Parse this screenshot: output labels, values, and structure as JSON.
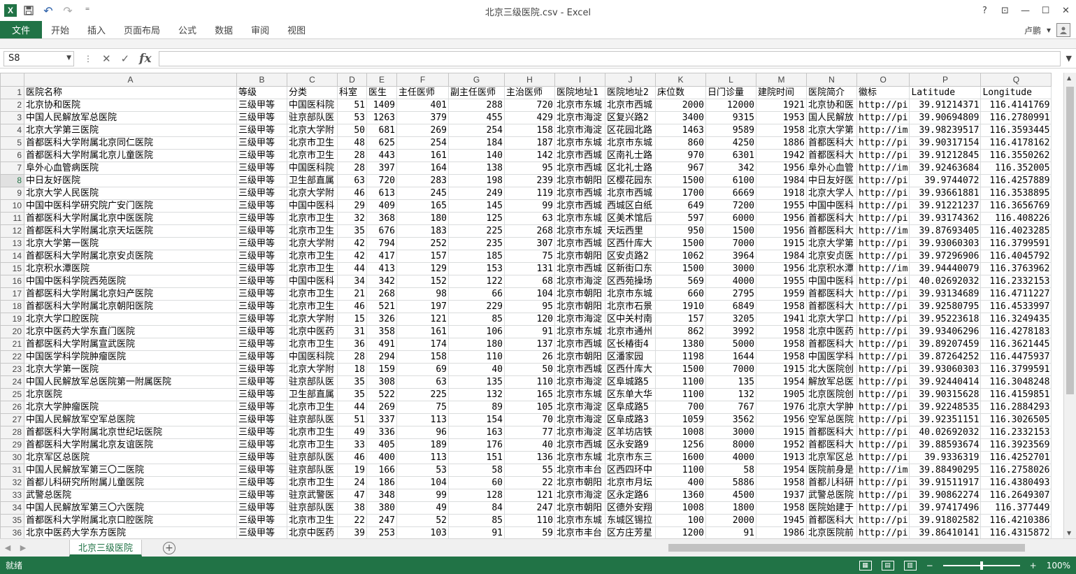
{
  "window": {
    "title": "北京三级医院.csv - Excel",
    "help": "?",
    "ribbon_display": "⊡",
    "minimize": "—",
    "maximize": "☐",
    "close": "✕"
  },
  "qat": {
    "app_icon": "X",
    "save_icon": "💾",
    "undo_icon": "↶",
    "redo_icon": "↷",
    "customize_icon": "⁼"
  },
  "ribbon": {
    "file_tab": "文件",
    "tabs": [
      "开始",
      "插入",
      "页面布局",
      "公式",
      "数据",
      "审阅",
      "视图"
    ],
    "user_name": "卢鹏",
    "user_dropdown": "▾"
  },
  "formula_bar": {
    "name_box": "S8",
    "cancel_icon": "✕",
    "enter_icon": "✓",
    "fx_label": "fx",
    "formula_value": ""
  },
  "grid": {
    "columns": [
      "A",
      "B",
      "C",
      "D",
      "E",
      "F",
      "G",
      "H",
      "I",
      "J",
      "K",
      "L",
      "M",
      "N",
      "O",
      "P",
      "Q"
    ],
    "selected_row": 8,
    "rows": [
      [
        "1",
        "医院名称",
        "等级",
        "分类",
        "科室",
        "医生",
        "主任医师",
        "副主任医师",
        "主治医师",
        "医院地址1",
        "医院地址2",
        "床位数",
        "日门诊量",
        "建院时间",
        "医院简介",
        "徽标",
        "Latitude",
        "Longitude"
      ],
      [
        "2",
        "北京协和医院",
        "三级甲等",
        "中国医科院",
        "51",
        "1409",
        "401",
        "288",
        "720",
        "北京市东城",
        "北京市西城",
        "2000",
        "12000",
        "1921",
        "北京协和医",
        "http://pi",
        "39.91214371",
        "116.4141769"
      ],
      [
        "3",
        "中国人民解放军总医院",
        "三级甲等",
        "驻京部队医",
        "53",
        "1263",
        "379",
        "455",
        "429",
        "北京市海淀",
        "区复兴路2",
        "3400",
        "9315",
        "1953",
        "国人民解放",
        "http://pi",
        "39.90694809",
        "116.2780991"
      ],
      [
        "4",
        "北京大学第三医院",
        "三级甲等",
        "北京大学附",
        "50",
        "681",
        "269",
        "254",
        "158",
        "北京市海淀",
        "区花园北路",
        "1463",
        "9589",
        "1958",
        "北京大学第",
        "http://im",
        "39.98239517",
        "116.3593445"
      ],
      [
        "5",
        "首都医科大学附属北京同仁医院",
        "三级甲等",
        "北京市卫生",
        "48",
        "625",
        "254",
        "184",
        "187",
        "北京市东城",
        "北京市东城",
        "860",
        "4250",
        "1886",
        "首都医科大",
        "http://pi",
        "39.90317154",
        "116.4178162"
      ],
      [
        "6",
        "首都医科大学附属北京儿童医院",
        "三级甲等",
        "北京市卫生",
        "28",
        "443",
        "161",
        "140",
        "142",
        "北京市西城",
        "区南礼士路",
        "970",
        "6301",
        "1942",
        "首都医科大",
        "http://pi",
        "39.91212845",
        "116.3550262"
      ],
      [
        "7",
        "阜外心血管病医院",
        "三级甲等",
        "中国医科院",
        "28",
        "397",
        "164",
        "138",
        "95",
        "北京市西城",
        "区北礼士路",
        "967",
        "342",
        "1956",
        "阜外心血管",
        "http://im",
        "39.92463684",
        "116.352005"
      ],
      [
        "8",
        "中日友好医院",
        "三级甲等",
        "卫生部直属",
        "63",
        "720",
        "283",
        "198",
        "239",
        "北京市朝阳",
        "区樱花园东",
        "1500",
        "6100",
        "1984",
        "中日友好医",
        "http://pi",
        "39.9744072",
        "116.4257889"
      ],
      [
        "9",
        "北京大学人民医院",
        "三级甲等",
        "北京大学附",
        "46",
        "613",
        "245",
        "249",
        "119",
        "北京市西城",
        "北京市西城",
        "1700",
        "6669",
        "1918",
        "北京大学人",
        "http://pi",
        "39.93661881",
        "116.3538895"
      ],
      [
        "10",
        "中国中医科学研究院广安门医院",
        "三级甲等",
        "中国中医科",
        "29",
        "409",
        "165",
        "145",
        "99",
        "北京市西城",
        "西城区白纸",
        "649",
        "7200",
        "1955",
        "中国中医科",
        "http://pi",
        "39.91221237",
        "116.3656769"
      ],
      [
        "11",
        "首都医科大学附属北京中医医院",
        "三级甲等",
        "北京市卫生",
        "32",
        "368",
        "180",
        "125",
        "63",
        "北京市东城",
        "区美术馆后",
        "597",
        "6000",
        "1956",
        "首都医科大",
        "http://pi",
        "39.93174362",
        "116.408226"
      ],
      [
        "12",
        "首都医科大学附属北京天坛医院",
        "三级甲等",
        "北京市卫生",
        "35",
        "676",
        "183",
        "225",
        "268",
        "北京市东城",
        "天坛西里",
        "950",
        "1500",
        "1956",
        "首都医科大",
        "http://im",
        "39.87693405",
        "116.4023285"
      ],
      [
        "13",
        "北京大学第一医院",
        "三级甲等",
        "北京大学附",
        "42",
        "794",
        "252",
        "235",
        "307",
        "北京市西城",
        "区西什库大",
        "1500",
        "7000",
        "1915",
        "北京大学第",
        "http://pi",
        "39.93060303",
        "116.3799591"
      ],
      [
        "14",
        "首都医科大学附属北京安贞医院",
        "三级甲等",
        "北京市卫生",
        "42",
        "417",
        "157",
        "185",
        "75",
        "北京市朝阳",
        "区安贞路2",
        "1062",
        "3964",
        "1984",
        "北京安贞医",
        "http://pi",
        "39.97296906",
        "116.4045792"
      ],
      [
        "15",
        "北京积水潭医院",
        "三级甲等",
        "北京市卫生",
        "44",
        "413",
        "129",
        "153",
        "131",
        "北京市西城",
        "区新街口东",
        "1500",
        "3000",
        "1956",
        "北京积水潭",
        "http://im",
        "39.94440079",
        "116.3763962"
      ],
      [
        "16",
        "中国中医科学院西苑医院",
        "三级甲等",
        "中国中医科",
        "34",
        "342",
        "152",
        "122",
        "68",
        "北京市海淀",
        "区西苑操场",
        "569",
        "4000",
        "1955",
        "中国中医科",
        "http://pi",
        "40.02692032",
        "116.2332153"
      ],
      [
        "17",
        "首都医科大学附属北京妇产医院",
        "三级甲等",
        "北京市卫生",
        "21",
        "268",
        "98",
        "66",
        "104",
        "北京市朝阳",
        "北京市东城",
        "660",
        "2795",
        "1959",
        "首都医科大",
        "http://pi",
        "39.93134689",
        "116.4711227"
      ],
      [
        "18",
        "首都医科大学附属北京朝阳医院",
        "三级甲等",
        "北京市卫生",
        "46",
        "521",
        "197",
        "229",
        "95",
        "北京市朝阳",
        "北京市石景",
        "1910",
        "6849",
        "1958",
        "首都医科大",
        "http://pi",
        "39.92580795",
        "116.4533997"
      ],
      [
        "19",
        "北京大学口腔医院",
        "三级甲等",
        "北京大学附",
        "15",
        "326",
        "121",
        "85",
        "120",
        "北京市海淀",
        "区中关村南",
        "157",
        "3205",
        "1941",
        "北京大学口",
        "http://pi",
        "39.95223618",
        "116.3249435"
      ],
      [
        "20",
        "北京中医药大学东直门医院",
        "三级甲等",
        "北京中医药",
        "31",
        "358",
        "161",
        "106",
        "91",
        "北京市东城",
        "北京市通州",
        "862",
        "3992",
        "1958",
        "北京中医药",
        "http://pi",
        "39.93406296",
        "116.4278183"
      ],
      [
        "21",
        "首都医科大学附属宣武医院",
        "三级甲等",
        "北京市卫生",
        "36",
        "491",
        "174",
        "180",
        "137",
        "北京市西城",
        "区长椿街4",
        "1380",
        "5000",
        "1958",
        "首都医科大",
        "http://pi",
        "39.89207459",
        "116.3621445"
      ],
      [
        "22",
        "中国医学科学院肿瘤医院",
        "三级甲等",
        "中国医科院",
        "28",
        "294",
        "158",
        "110",
        "26",
        "北京市朝阳",
        "区潘家园",
        "1198",
        "1644",
        "1958",
        "中国医学科",
        "http://pi",
        "39.87264252",
        "116.4475937"
      ],
      [
        "23",
        "北京大学第一医院",
        "三级甲等",
        "北京大学附",
        "18",
        "159",
        "69",
        "40",
        "50",
        "北京市西城",
        "区西什库大",
        "1500",
        "7000",
        "1915",
        "北大医院创",
        "http://pi",
        "39.93060303",
        "116.3799591"
      ],
      [
        "24",
        "中国人民解放军总医院第一附属医院",
        "三级甲等",
        "驻京部队医",
        "35",
        "308",
        "63",
        "135",
        "110",
        "北京市海淀",
        "区阜城路5",
        "1100",
        "135",
        "1954",
        "解放军总医",
        "http://pi",
        "39.92440414",
        "116.3048248"
      ],
      [
        "25",
        "北京医院",
        "三级甲等",
        "卫生部直属",
        "35",
        "522",
        "225",
        "132",
        "165",
        "北京市东城",
        "区东单大华",
        "1100",
        "132",
        "1905",
        "北京医院创",
        "http://pi",
        "39.90315628",
        "116.4159851"
      ],
      [
        "26",
        "北京大学肿瘤医院",
        "三级甲等",
        "北京市卫生",
        "44",
        "269",
        "75",
        "89",
        "105",
        "北京市海淀",
        "区阜成路5",
        "700",
        "767",
        "1976",
        "北京大学肿",
        "http://pi",
        "39.92248535",
        "116.2884293"
      ],
      [
        "27",
        "中国人民解放军空军总医院",
        "三级甲等",
        "驻京部队医",
        "51",
        "337",
        "113",
        "154",
        "70",
        "北京市海淀",
        "区阜成路3",
        "1059",
        "3562",
        "1956",
        "空军总医院",
        "http://pi",
        "39.92351151",
        "116.3026505"
      ],
      [
        "28",
        "首都医科大学附属北京世纪坛医院",
        "三级甲等",
        "北京市卫生",
        "49",
        "336",
        "96",
        "163",
        "77",
        "北京市海淀",
        "区羊坊店铁",
        "1008",
        "3000",
        "1915",
        "首都医科大",
        "http://pi",
        "40.02692032",
        "116.2332153"
      ],
      [
        "29",
        "首都医科大学附属北京友谊医院",
        "三级甲等",
        "北京市卫生",
        "33",
        "405",
        "189",
        "176",
        "40",
        "北京市西城",
        "区永安路9",
        "1256",
        "8000",
        "1952",
        "首都医科大",
        "http://pi",
        "39.88593674",
        "116.3923569"
      ],
      [
        "30",
        "北京军区总医院",
        "三级甲等",
        "驻京部队医",
        "46",
        "400",
        "113",
        "151",
        "136",
        "北京市东城",
        "北京市东三",
        "1600",
        "4000",
        "1913",
        "北京军区总",
        "http://pi",
        "39.9336319",
        "116.4252701"
      ],
      [
        "31",
        "中国人民解放军第三〇二医院",
        "三级甲等",
        "驻京部队医",
        "19",
        "166",
        "53",
        "58",
        "55",
        "北京市丰台",
        "区西四环中",
        "1100",
        "58",
        "1954",
        "医院前身是",
        "http://im",
        "39.88490295",
        "116.2758026"
      ],
      [
        "32",
        "首都儿科研究所附属儿童医院",
        "三级甲等",
        "北京市卫生",
        "24",
        "186",
        "104",
        "60",
        "22",
        "北京市朝阳",
        "北京市月坛",
        "400",
        "5886",
        "1958",
        "首都儿科研",
        "http://pi",
        "39.91511917",
        "116.4380493"
      ],
      [
        "33",
        "武警总医院",
        "三级甲等",
        "驻京武警医",
        "47",
        "348",
        "99",
        "128",
        "121",
        "北京市海淀",
        "区永定路6",
        "1360",
        "4500",
        "1937",
        "武警总医院",
        "http://pi",
        "39.90862274",
        "116.2649307"
      ],
      [
        "34",
        "中国人民解放军第三〇六医院",
        "三级甲等",
        "驻京部队医",
        "38",
        "380",
        "49",
        "84",
        "247",
        "北京市朝阳",
        "区德外安翔",
        "1008",
        "1800",
        "1958",
        "医院始建于",
        "http://pi",
        "39.97417496",
        "116.377449"
      ],
      [
        "35",
        "首都医科大学附属北京口腔医院",
        "三级甲等",
        "北京市卫生",
        "22",
        "247",
        "52",
        "85",
        "110",
        "北京市东城",
        "东城区锡拉",
        "100",
        "2000",
        "1945",
        "首都医科大",
        "http://pi",
        "39.91802582",
        "116.4210386"
      ],
      [
        "36",
        "北京中医药大学东方医院",
        "三级甲等",
        "北京中医药",
        "39",
        "253",
        "103",
        "91",
        "59",
        "北京市丰台",
        "区方庄芳星",
        "1200",
        "91",
        "1986",
        "北京医院前",
        "http://pi",
        "39.86410141",
        "116.4315872"
      ]
    ]
  },
  "sheet_tabs": {
    "prev_arrow": "◀",
    "next_arrow": "▶",
    "active_tab": "北京三级医院",
    "add_sheet": "+"
  },
  "status": {
    "ready": "就绪",
    "zoom_level": "100%",
    "zoom_minus": "−",
    "zoom_plus": "+"
  }
}
